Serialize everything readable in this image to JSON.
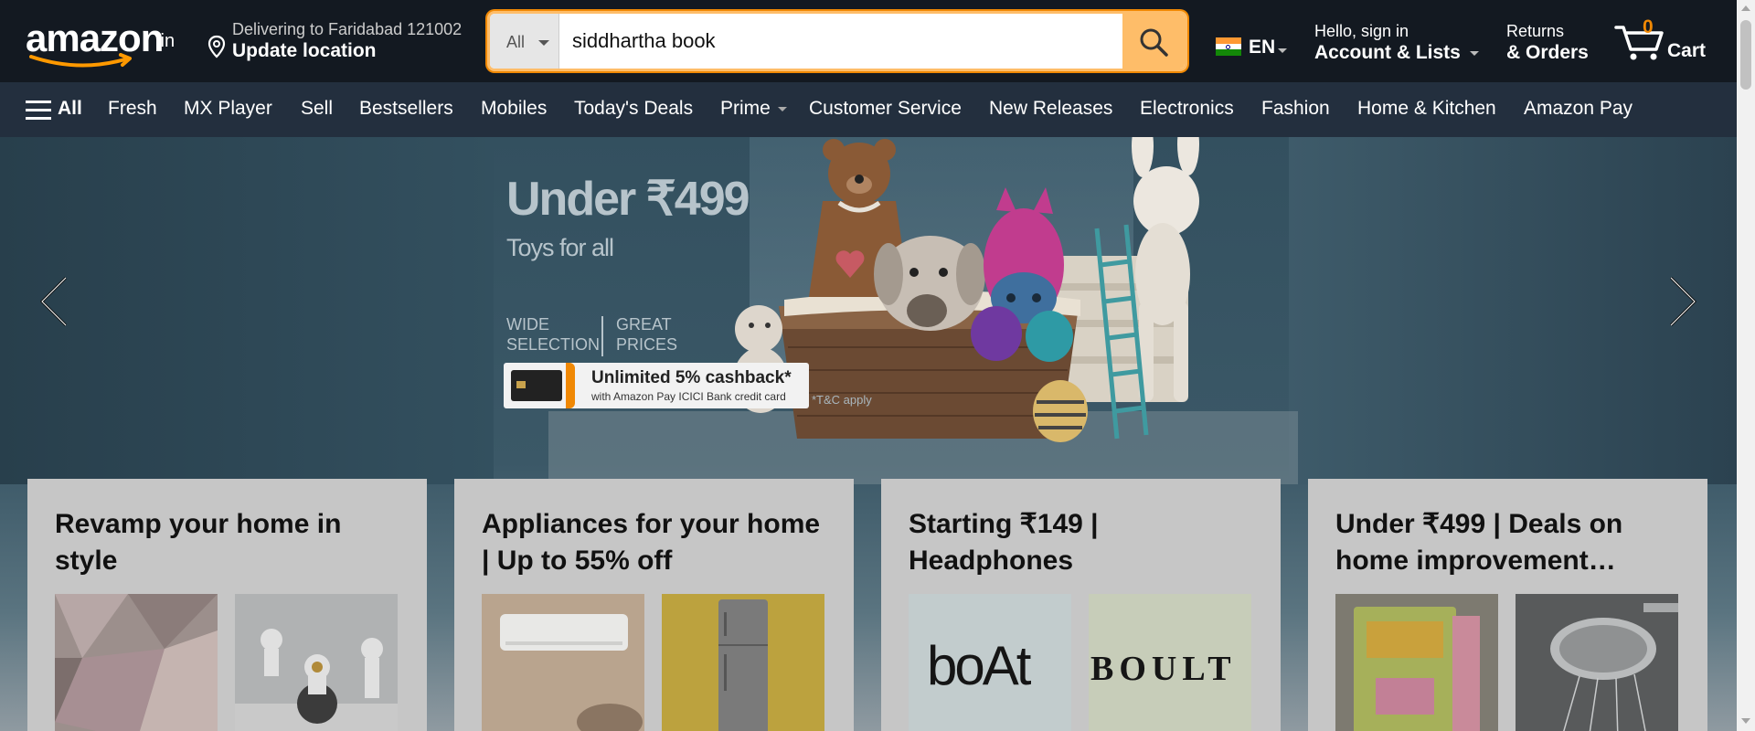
{
  "header": {
    "logo": {
      "text": "amazon",
      "suffix": ".in"
    },
    "location": {
      "line1": "Delivering to Faridabad 121002",
      "line2": "Update location"
    },
    "search": {
      "category": "All",
      "value": "siddhartha book",
      "icon": "search-icon"
    },
    "language": {
      "label": "EN",
      "flag": "india-flag-icon"
    },
    "account": {
      "line1": "Hello, sign in",
      "line2": "Account & Lists"
    },
    "orders": {
      "line1": "Returns",
      "line2": "& Orders"
    },
    "cart": {
      "count": "0",
      "label": "Cart",
      "icon": "cart-icon"
    }
  },
  "nav": {
    "all_label": "All",
    "items": [
      {
        "label": "Fresh"
      },
      {
        "label": "MX Player"
      },
      {
        "label": "Sell"
      },
      {
        "label": "Bestsellers"
      },
      {
        "label": "Mobiles"
      },
      {
        "label": "Today's Deals"
      },
      {
        "label": "Prime"
      },
      {
        "label": "Customer Service"
      },
      {
        "label": "New Releases"
      },
      {
        "label": "Electronics"
      },
      {
        "label": "Fashion"
      },
      {
        "label": "Home & Kitchen"
      },
      {
        "label": "Amazon Pay"
      }
    ]
  },
  "hero": {
    "headline": "Under ₹499",
    "subhead": "Toys for all",
    "feature1": "WIDE SELECTION",
    "feature2": "GREAT PRICES",
    "cashback_line1": "Unlimited 5% cashback*",
    "cashback_line2": "with Amazon Pay ICICI Bank credit card",
    "terms": "*T&C apply"
  },
  "cards": [
    {
      "title": "Revamp your home in style"
    },
    {
      "title": "Appliances for your home | Up to 55% off"
    },
    {
      "title": "Starting ₹149 | Headphones",
      "brand1": "boAt",
      "brand2": "BOULT"
    },
    {
      "title": "Under ₹499 | Deals on home improvement…"
    }
  ],
  "colors": {
    "header_bg": "#131921",
    "nav_bg": "#232f3e",
    "accent": "#febd69",
    "cart_count": "#f08804"
  }
}
